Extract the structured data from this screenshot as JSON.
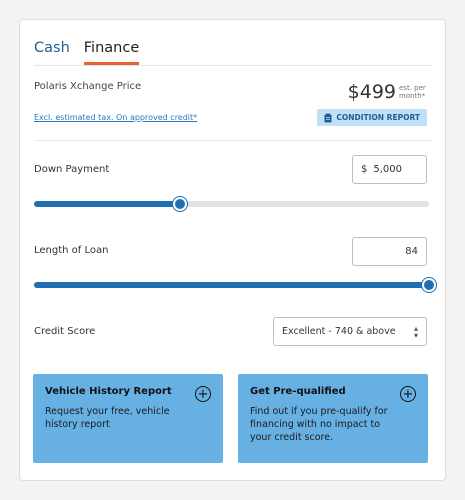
{
  "tabs": [
    {
      "label": "Cash",
      "active": false
    },
    {
      "label": "Finance",
      "active": true
    }
  ],
  "pricing": {
    "label": "Polaris Xchange Price",
    "value": "$499",
    "note": "est. per month*",
    "tax_link": "Excl. estimated tax. On approved credit*",
    "condition_button": "CONDITION REPORT",
    "condition_icon": "clipboard-icon"
  },
  "down_payment": {
    "label": "Down Payment",
    "currency": "$",
    "value": "5,000",
    "slider_percent": 37
  },
  "loan_length": {
    "label": "Length of Loan",
    "value": "84",
    "slider_percent": 100
  },
  "credit_score": {
    "label": "Credit Score",
    "selected": "Excellent - 740 & above"
  },
  "promos": [
    {
      "title": "Vehicle History Report",
      "text": "Request your free, vehicle history report",
      "icon": "plus-circle-icon"
    },
    {
      "title": "Get Pre-qualified",
      "text": "Find out if you pre-qualify for financing with no impact to your credit score.",
      "icon": "plus-circle-icon"
    }
  ],
  "colors": {
    "accent": "#1f6fb2",
    "tab_underline": "#e8602c",
    "promo_bg": "#67b0e3",
    "condition_bg": "#bfe0f7"
  }
}
